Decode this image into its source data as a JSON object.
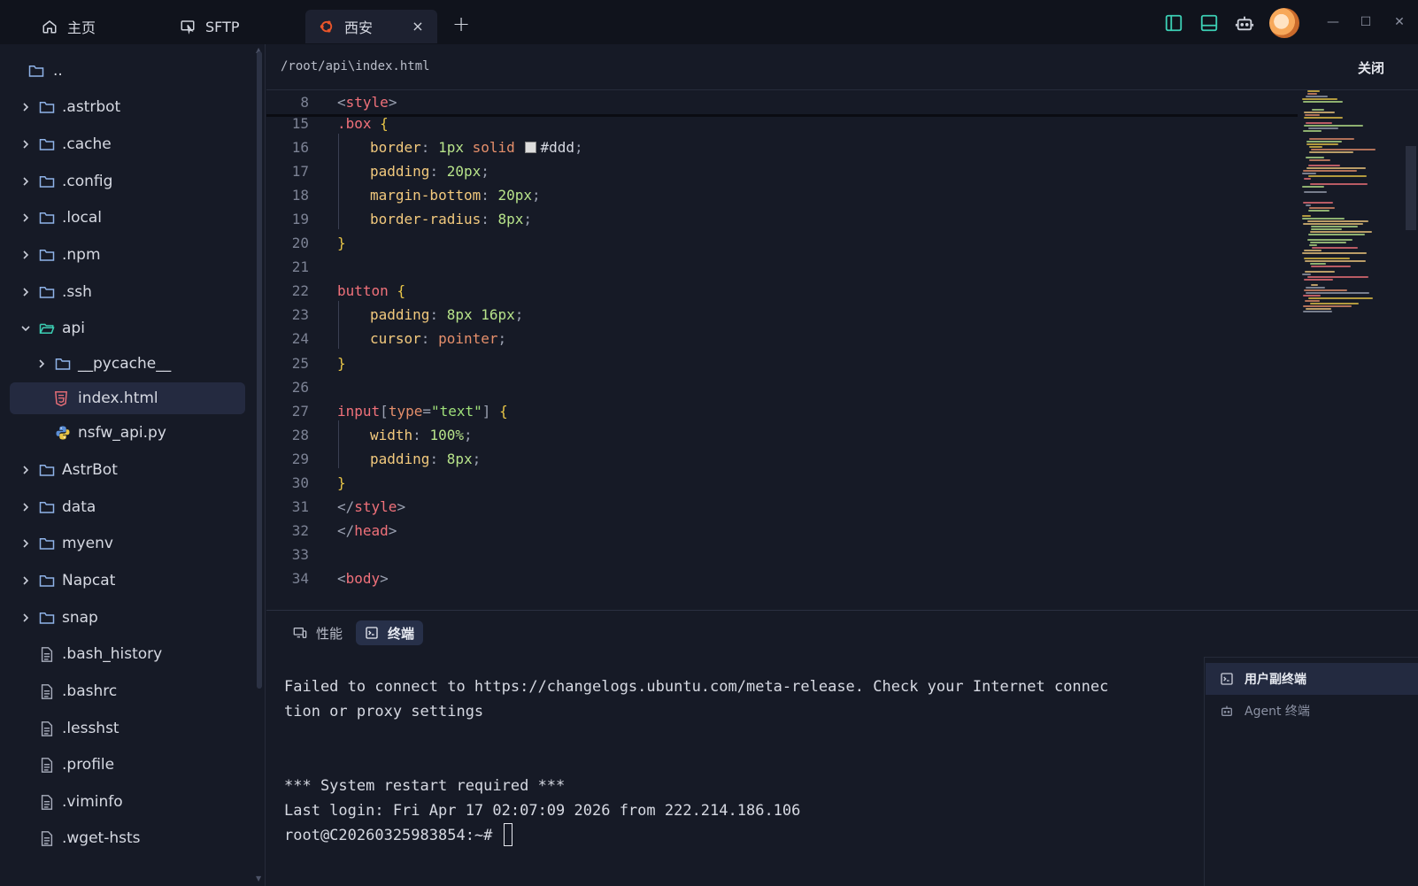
{
  "titlebar": {
    "tabs": [
      {
        "label": "主页",
        "icon": "home-icon"
      },
      {
        "label": "SFTP",
        "icon": "sftp-icon"
      },
      {
        "label": "西安",
        "icon": "ubuntu-icon",
        "close": "×"
      }
    ],
    "add_tab": "+",
    "window_controls": {
      "minimize": "—",
      "maximize": "☐",
      "close": "✕"
    }
  },
  "sidebar": {
    "items": [
      {
        "label": "..",
        "type": "folder"
      },
      {
        "label": ".astrbot",
        "type": "folder"
      },
      {
        "label": ".cache",
        "type": "folder"
      },
      {
        "label": ".config",
        "type": "folder"
      },
      {
        "label": ".local",
        "type": "folder"
      },
      {
        "label": ".npm",
        "type": "folder"
      },
      {
        "label": ".ssh",
        "type": "folder"
      },
      {
        "label": "api",
        "type": "folder-open"
      },
      {
        "label": "__pycache__",
        "type": "folder"
      },
      {
        "label": "index.html",
        "type": "html-file",
        "selected": true
      },
      {
        "label": "nsfw_api.py",
        "type": "python-file"
      },
      {
        "label": "AstrBot",
        "type": "folder"
      },
      {
        "label": "data",
        "type": "folder"
      },
      {
        "label": "myenv",
        "type": "folder"
      },
      {
        "label": "Napcat",
        "type": "folder"
      },
      {
        "label": "snap",
        "type": "folder"
      },
      {
        "label": ".bash_history",
        "type": "file"
      },
      {
        "label": ".bashrc",
        "type": "file"
      },
      {
        "label": ".lesshst",
        "type": "file"
      },
      {
        "label": ".profile",
        "type": "file"
      },
      {
        "label": ".viminfo",
        "type": "file"
      },
      {
        "label": ".wget-hsts",
        "type": "file"
      }
    ]
  },
  "editor": {
    "path": "/root/api\\index.html",
    "close_label": "关闭",
    "sticky": {
      "num": "8",
      "text": "<style>"
    },
    "lines": [
      {
        "num": "15",
        "text": ".box {"
      },
      {
        "num": "16",
        "text": "border: 1px solid #ddd;"
      },
      {
        "num": "17",
        "text": "padding: 20px;"
      },
      {
        "num": "18",
        "text": "margin-bottom: 20px;"
      },
      {
        "num": "19",
        "text": "border-radius: 8px;"
      },
      {
        "num": "20",
        "text": "}"
      },
      {
        "num": "21",
        "text": ""
      },
      {
        "num": "22",
        "text": "button {"
      },
      {
        "num": "23",
        "text": "padding: 8px 16px;"
      },
      {
        "num": "24",
        "text": "cursor: pointer;"
      },
      {
        "num": "25",
        "text": "}"
      },
      {
        "num": "26",
        "text": ""
      },
      {
        "num": "27",
        "text": "input[type=\"text\"] {"
      },
      {
        "num": "28",
        "text": "width: 100%;"
      },
      {
        "num": "29",
        "text": "padding: 8px;"
      },
      {
        "num": "30",
        "text": "}"
      },
      {
        "num": "31",
        "text": "</style>"
      },
      {
        "num": "32",
        "text": "</head>"
      },
      {
        "num": "33",
        "text": ""
      },
      {
        "num": "34",
        "text": "<body>"
      }
    ]
  },
  "panel": {
    "tabs": [
      {
        "label": "性能",
        "active": false
      },
      {
        "label": "终端",
        "active": true
      }
    ],
    "terminal_lines": [
      "Failed to connect to https://changelogs.ubuntu.com/meta-release. Check your Internet connec",
      "tion or proxy settings",
      "",
      "",
      "*** System restart required ***",
      "Last login: Fri Apr 17 02:07:09 2026 from 222.214.186.106"
    ],
    "prompt": "root@C20260325983854:~#",
    "side_items": [
      {
        "label": "用户副终端",
        "active": true
      },
      {
        "label": "Agent 终端",
        "active": false
      }
    ]
  },
  "colors": {
    "accent": "#3ccfb4",
    "background": "#161a26",
    "titlebar": "#10131c",
    "selection": "#242a40"
  }
}
